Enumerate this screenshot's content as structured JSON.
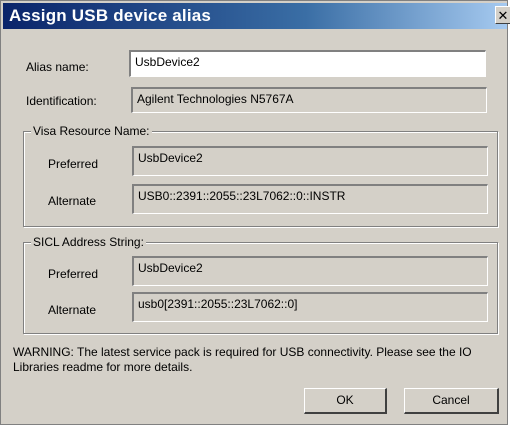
{
  "window": {
    "title": "Assign USB device alias",
    "close_glyph": "✕"
  },
  "alias": {
    "label": "Alias name:",
    "value": "UsbDevice2"
  },
  "identification": {
    "label": "Identification:",
    "value": "Agilent Technologies N5767A"
  },
  "visa": {
    "group_title": "Visa Resource Name:",
    "preferred_label": "Preferred",
    "preferred_value": "UsbDevice2",
    "alternate_label": "Alternate",
    "alternate_value": "USB0::2391::2055::23L7062::0::INSTR"
  },
  "sicl": {
    "group_title": "SICL Address String:",
    "preferred_label": "Preferred",
    "preferred_value": "UsbDevice2",
    "alternate_label": "Alternate",
    "alternate_value": "usb0[2391::2055::23L7062::0]"
  },
  "warning": "WARNING: The latest service pack is required for USB connectivity.  Please see the IO Libraries readme for more details.",
  "buttons": {
    "ok": "OK",
    "cancel": "Cancel"
  },
  "colors": {
    "titlebar_start": "#0a246a",
    "titlebar_end": "#a6caf0",
    "dialog_face": "#d4d0c8"
  }
}
